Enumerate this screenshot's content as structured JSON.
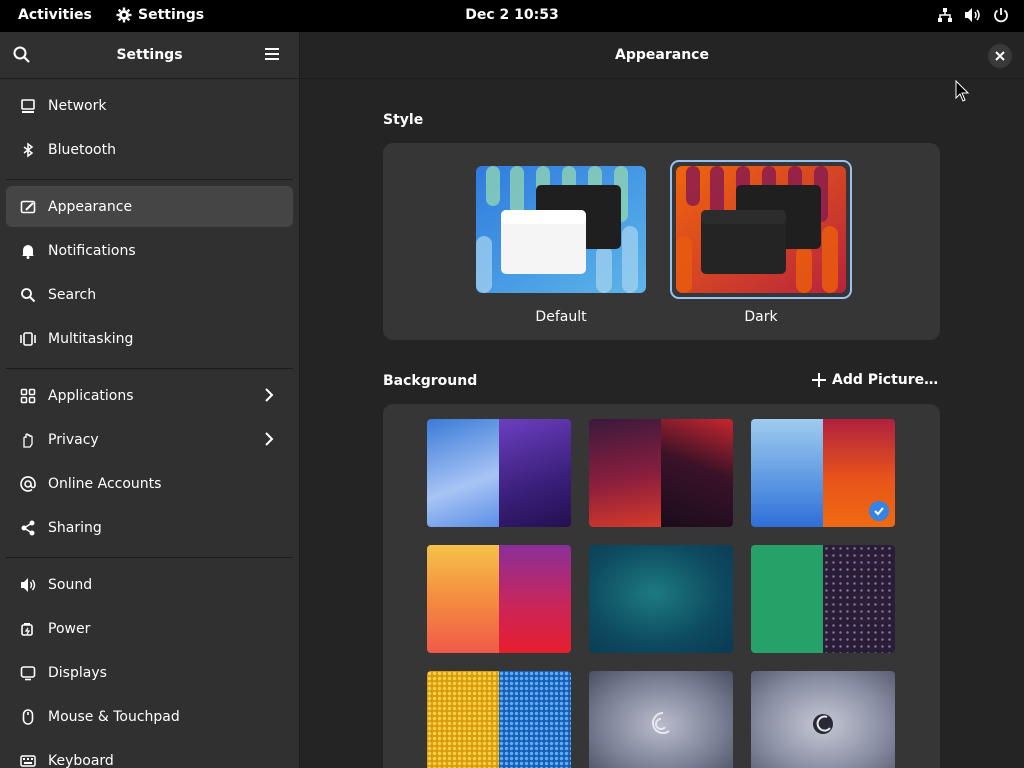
{
  "topbar": {
    "activities": "Activities",
    "app_name": "Settings",
    "clock": "Dec 2  10:53",
    "icons": [
      "network-icon",
      "volume-icon",
      "power-icon"
    ]
  },
  "sidebar": {
    "title": "Settings",
    "items": [
      {
        "label": "Network",
        "icon": "network-icon"
      },
      {
        "label": "Bluetooth",
        "icon": "bluetooth-icon"
      },
      {
        "label": "Appearance",
        "icon": "appearance-icon",
        "active": true
      },
      {
        "label": "Notifications",
        "icon": "bell-icon"
      },
      {
        "label": "Search",
        "icon": "search-icon"
      },
      {
        "label": "Multitasking",
        "icon": "multitasking-icon"
      },
      {
        "label": "Applications",
        "icon": "applications-icon",
        "chevron": true
      },
      {
        "label": "Privacy",
        "icon": "privacy-icon",
        "chevron": true
      },
      {
        "label": "Online Accounts",
        "icon": "at-icon"
      },
      {
        "label": "Sharing",
        "icon": "share-icon"
      },
      {
        "label": "Sound",
        "icon": "sound-icon"
      },
      {
        "label": "Power",
        "icon": "power-icon"
      },
      {
        "label": "Displays",
        "icon": "display-icon"
      },
      {
        "label": "Mouse & Touchpad",
        "icon": "mouse-icon"
      },
      {
        "label": "Keyboard",
        "icon": "keyboard-icon"
      }
    ]
  },
  "content": {
    "title": "Appearance",
    "style_section": "Style",
    "styles": [
      {
        "label": "Default",
        "selected": false
      },
      {
        "label": "Dark",
        "selected": true
      }
    ],
    "background_section": "Background",
    "add_picture": "Add Picture…",
    "selected_background_index": 2
  },
  "colors": {
    "accent": "#3584e4",
    "selection_ring": "#99c1f1",
    "sidebar_bg": "#303030",
    "content_bg": "#242424",
    "card_bg": "#363636"
  }
}
